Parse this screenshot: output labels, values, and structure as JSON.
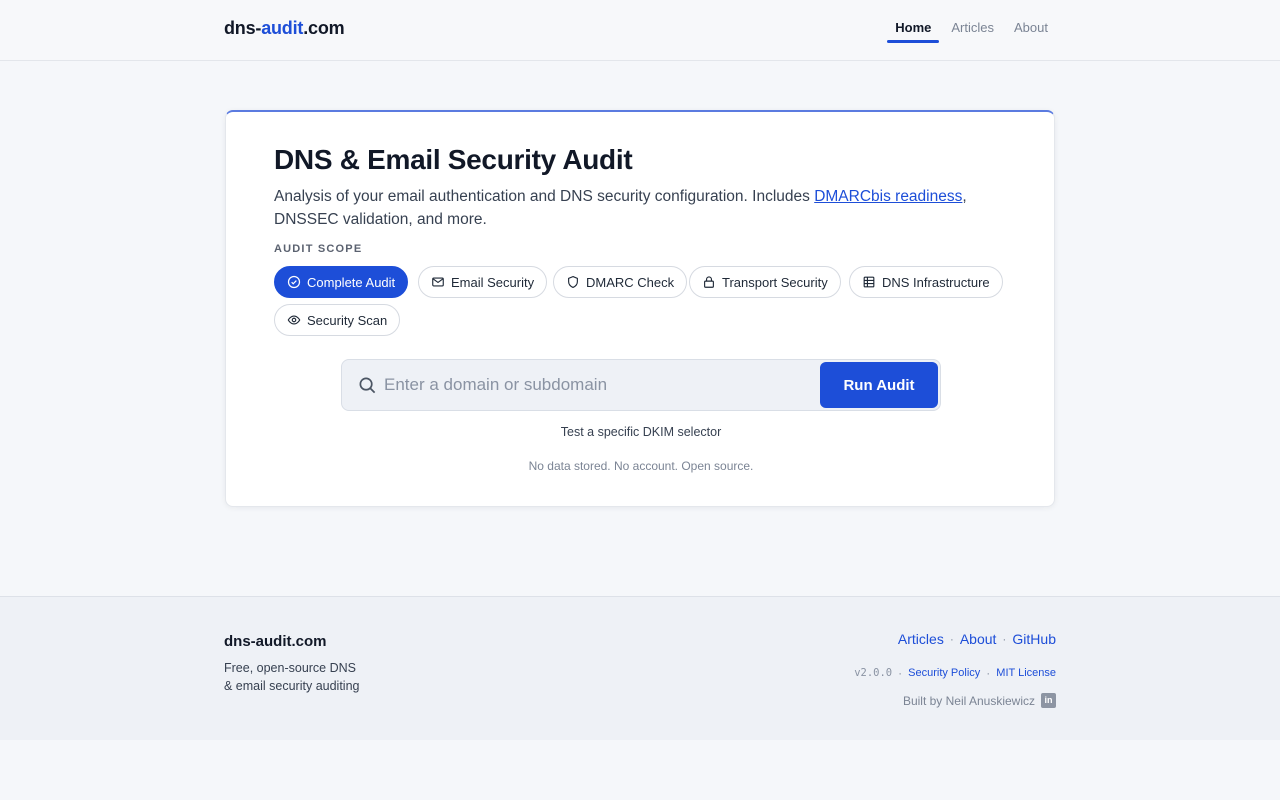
{
  "header": {
    "brand_prefix": "dns-",
    "brand_accent": "audit",
    "brand_suffix": ".com",
    "nav": [
      "Home",
      "Articles",
      "About"
    ],
    "active_nav": "Home"
  },
  "card": {
    "title": "DNS & Email Security Audit",
    "description_text": "Analysis of your email authentication and DNS security configuration. Includes ",
    "description_link": "DMARCbis readiness",
    "description_tail": ", DNSSEC validation, and more.",
    "scope_label": "AUDIT SCOPE",
    "chips": [
      {
        "label": "Complete Audit",
        "icon": "check-circle-icon",
        "active": true
      },
      {
        "label": "Email Security",
        "icon": "mail-icon",
        "active": false
      },
      {
        "label": "DMARC Check",
        "icon": "shield-icon",
        "active": false
      },
      {
        "label": "Transport Security",
        "icon": "lock-icon",
        "active": false
      },
      {
        "label": "DNS Infrastructure",
        "icon": "table-icon",
        "active": false
      },
      {
        "label": "Security Scan",
        "icon": "eye-icon",
        "active": false
      }
    ],
    "search": {
      "placeholder": "Enter a domain or subdomain",
      "value": "",
      "button_label": "Run Audit"
    },
    "dkim_link": "Test a specific DKIM selector",
    "privacy_note": "No data stored. No account. Open source."
  },
  "footer": {
    "brand": "dns-audit.com",
    "tagline_line1": "Free, open-source DNS",
    "tagline_line2": "& email security auditing",
    "links": [
      "Articles",
      "About",
      "GitHub"
    ],
    "version": "v2.0.0",
    "security_policy": "Security Policy",
    "license": "MIT License",
    "built_by": "Built by Neil Anuskiewicz",
    "social_icon": "linkedin-icon"
  },
  "colors": {
    "accent": "#1d4ed8",
    "page_bg": "#f5f7fa",
    "footer_bg": "#eef1f6"
  }
}
